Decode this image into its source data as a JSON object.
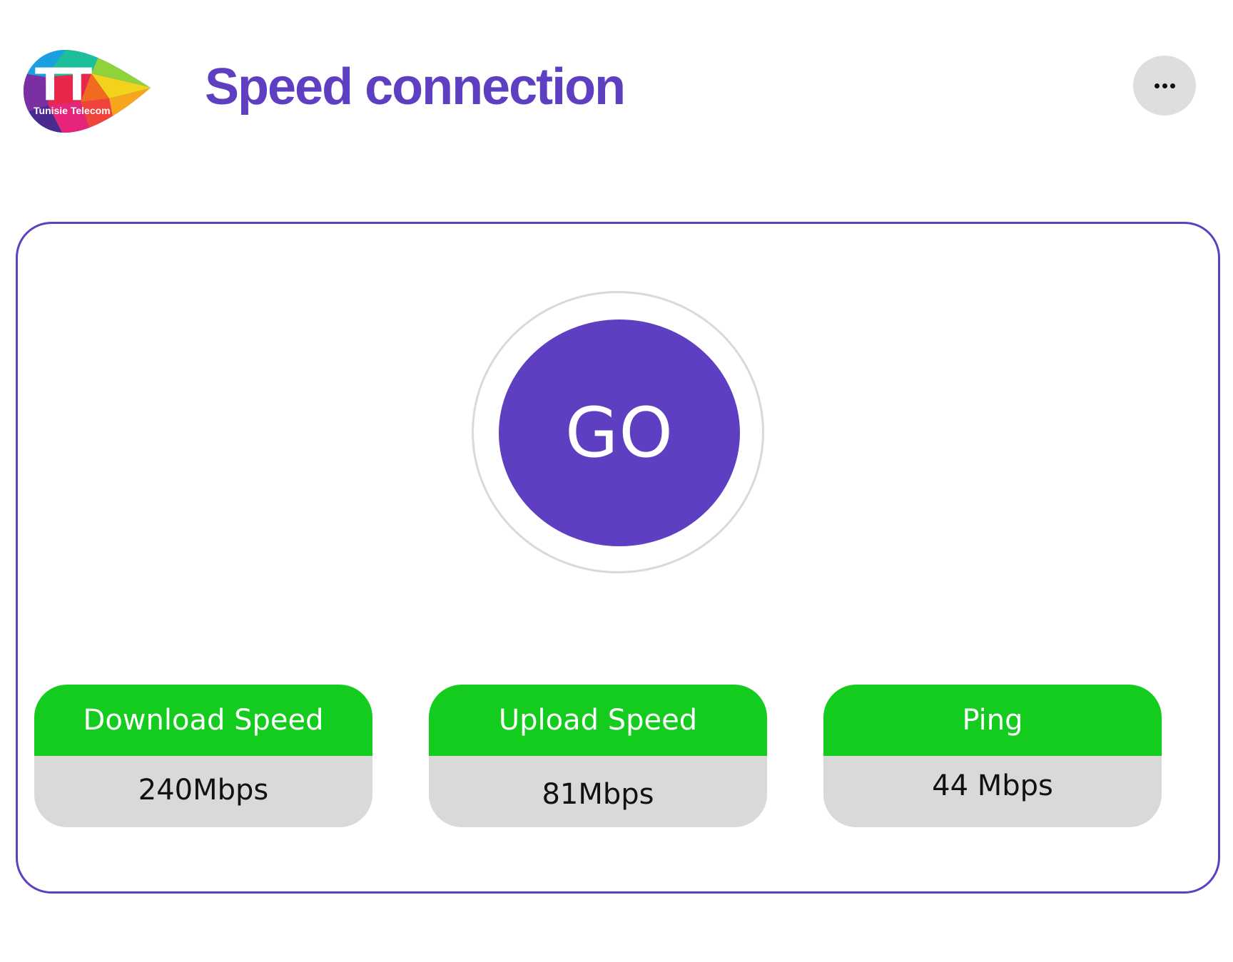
{
  "colors": {
    "brand": "#5e3fc1",
    "accent_green": "#14cc1e",
    "value_bg": "#d9d9d9",
    "more_button_bg": "#dedede",
    "ring": "#d9d9d9"
  },
  "header": {
    "logo": {
      "icon": "tunisie-telecom-logo",
      "text": "Tunisie Telecom",
      "mark": "TT"
    },
    "title": "Speed connection",
    "more_button": {
      "icon": "more-horizontal-icon"
    }
  },
  "go_button": {
    "label": "GO"
  },
  "metrics": [
    {
      "label": "Download Speed",
      "value": "240Mbps"
    },
    {
      "label": "Upload Speed",
      "value": "81Mbps"
    },
    {
      "label": "Ping",
      "value": "44 Mbps"
    }
  ]
}
